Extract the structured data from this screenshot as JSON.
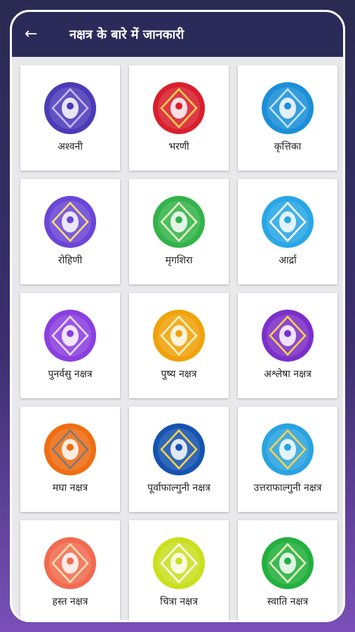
{
  "header": {
    "back_icon": "arrow-left-icon",
    "title": "नक्षत्र के बारे में जानकारी"
  },
  "nakshatras": [
    {
      "label": "अश्वनी",
      "icon": "horse-icon",
      "color": "#4b3bb8",
      "accent": "#c8b8ff"
    },
    {
      "label": "भरणी",
      "icon": "heart-diamond-icon",
      "color": "#d91f2e",
      "accent": "#ffd34d"
    },
    {
      "label": "कृत्तिका",
      "icon": "knife-icon",
      "color": "#1a8fd8",
      "accent": "#bfe6ff"
    },
    {
      "label": "रोहिणी",
      "icon": "chariot-icon",
      "color": "#6a46d8",
      "accent": "#ffe06a"
    },
    {
      "label": "मृगशिरा",
      "icon": "deer-icon",
      "color": "#33b34a",
      "accent": "#eaffc2"
    },
    {
      "label": "आर्द्रा",
      "icon": "head-icon",
      "color": "#28a6e6",
      "accent": "#ffffff"
    },
    {
      "label": "पुनर्वसु नक्षत्र",
      "icon": "quiver-icon",
      "color": "#8a3fe0",
      "accent": "#f0d9ff"
    },
    {
      "label": "पुष्य नक्षत्र",
      "icon": "lotus-icon",
      "color": "#f0a20a",
      "accent": "#fff3c4"
    },
    {
      "label": "अश्लेषा नक्षत्र",
      "icon": "serpent-icon",
      "color": "#7b2fc9",
      "accent": "#ffd24a"
    },
    {
      "label": "मघा नक्षत्र",
      "icon": "throne-icon",
      "color": "#ef6d13",
      "accent": "#7a7a7a"
    },
    {
      "label": "पूर्वाफाल्गुनी नक्षत्र",
      "icon": "bed-icon",
      "color": "#1553b0",
      "accent": "#ffd34d"
    },
    {
      "label": "उत्तराफाल्गुनी नक्षत्र",
      "icon": "bed-legs-icon",
      "color": "#2aa3e0",
      "accent": "#ffd34d"
    },
    {
      "label": "हस्त नक्षत्र",
      "icon": "hand-icon",
      "color": "#f26a4f",
      "accent": "#ffe1b0"
    },
    {
      "label": "चित्रा नक्षत्र",
      "icon": "pearl-shell-icon",
      "color": "#c9e01f",
      "accent": "#ffffff"
    },
    {
      "label": "स्वाति नक्षत्र",
      "icon": "tree-icon",
      "color": "#22b03e",
      "accent": "#eaffc2"
    }
  ]
}
